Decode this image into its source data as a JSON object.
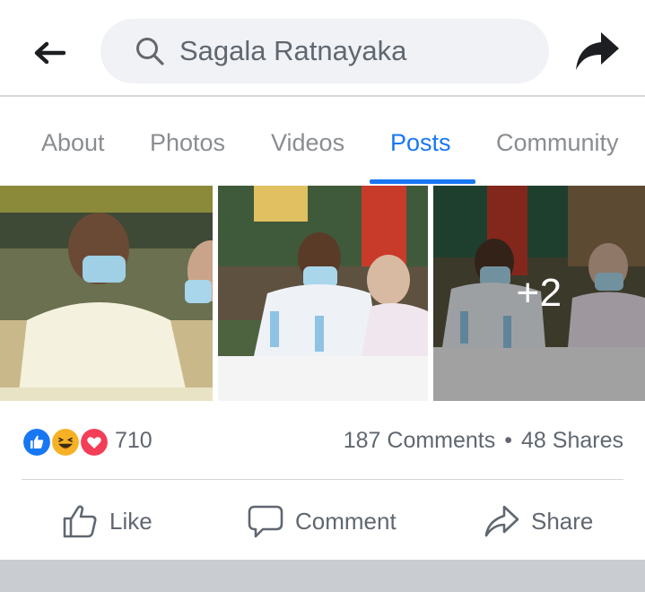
{
  "header": {
    "search_value": "Sagala Ratnayaka"
  },
  "tabs": [
    {
      "label": "About",
      "active": false
    },
    {
      "label": "Photos",
      "active": false
    },
    {
      "label": "Videos",
      "active": false
    },
    {
      "label": "Posts",
      "active": true
    },
    {
      "label": "Community",
      "active": false
    }
  ],
  "post": {
    "more_photos_label": "+2",
    "reaction_types": [
      "like",
      "haha",
      "love"
    ],
    "reaction_count": "710",
    "comments": "187 Comments",
    "separator": "•",
    "shares": "48 Shares"
  },
  "actions": {
    "like": "Like",
    "comment": "Comment",
    "share": "Share"
  },
  "colors": {
    "accent": "#1877f2",
    "muted_text": "#606770",
    "search_bg": "#f0f2f5",
    "like_blue": "#1877f2",
    "love_red": "#f33e58",
    "haha_yellow": "#f7b125"
  },
  "icons": [
    "back-arrow-icon",
    "search-icon",
    "share-arrow-icon",
    "thumbs-up-icon",
    "comment-bubble-icon",
    "share-outline-icon"
  ]
}
